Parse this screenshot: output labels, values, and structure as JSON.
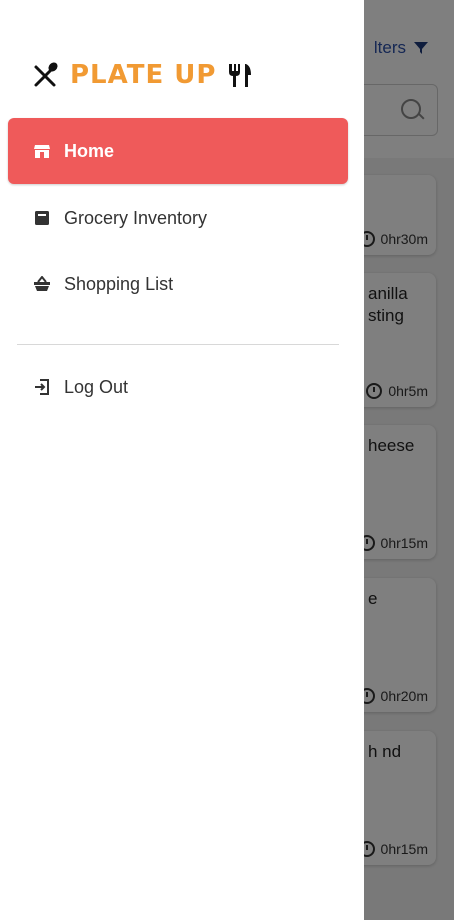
{
  "brand": {
    "name": "PLATE UP"
  },
  "nav": {
    "items": [
      {
        "label": "Home",
        "icon": "store-icon",
        "active": true
      },
      {
        "label": "Grocery Inventory",
        "icon": "box-icon",
        "active": false
      },
      {
        "label": "Shopping List",
        "icon": "basket-icon",
        "active": false
      }
    ],
    "logout": {
      "label": "Log Out",
      "icon": "logout-icon"
    }
  },
  "background": {
    "filters_label": "lters",
    "cards": [
      {
        "title": "",
        "time": "0hr30m"
      },
      {
        "title": "anilla sting",
        "time": "0hr5m"
      },
      {
        "title": "heese",
        "time": "0hr15m"
      },
      {
        "title": "e",
        "time": "0hr20m"
      },
      {
        "title": "h nd",
        "time": "0hr15m"
      }
    ]
  },
  "colors": {
    "accent": "#ef5a5a",
    "brand": "#f19a33",
    "link": "#2b4fa8"
  }
}
